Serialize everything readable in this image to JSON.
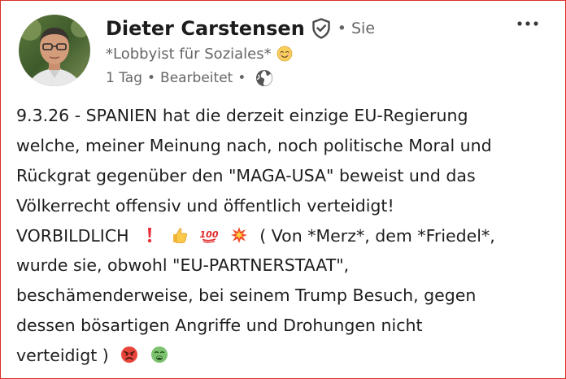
{
  "author": {
    "name": "Dieter Carstensen",
    "degree": "Sie",
    "headline": "*Lobbyist für Soziales*",
    "headline_icon": "smiling-face-icon"
  },
  "meta": {
    "time": "1 Tag",
    "edited": "Bearbeitet",
    "visibility_icon": "globe-icon"
  },
  "post": {
    "line1": "9.3.26 - SPANIEN hat die derzeit einzige EU-Regierung",
    "line2": "welche, meiner Meinung nach, noch politische Moral und",
    "line3": "Rückgrat gegenüber den \"MAGA-USA\" beweist und das",
    "line4": "Völkerrecht offensiv und öffentlich verteidigt!",
    "line5_a": "VORBILDLICH",
    "line5_b": "( Von *Merz*, dem *Friedel*,",
    "line6": "wurde sie, obwohl \"EU-PARTNERSTAAT\",",
    "line7": "beschämenderweise, bei seinem Trump Besuch, gegen",
    "line8": "dessen bösartigen Angriffe und Drohungen nicht",
    "line9": "verteidigt )",
    "emojis_line5": [
      "exclamation-icon",
      "thumbs-up-icon",
      "hundred-points-icon",
      "collision-icon"
    ],
    "emojis_line9": [
      "angry-face-icon",
      "nauseated-face-icon"
    ]
  },
  "colors": {
    "text": "#1d1d1d",
    "secondary": "#666666",
    "frame": "#d93025"
  }
}
